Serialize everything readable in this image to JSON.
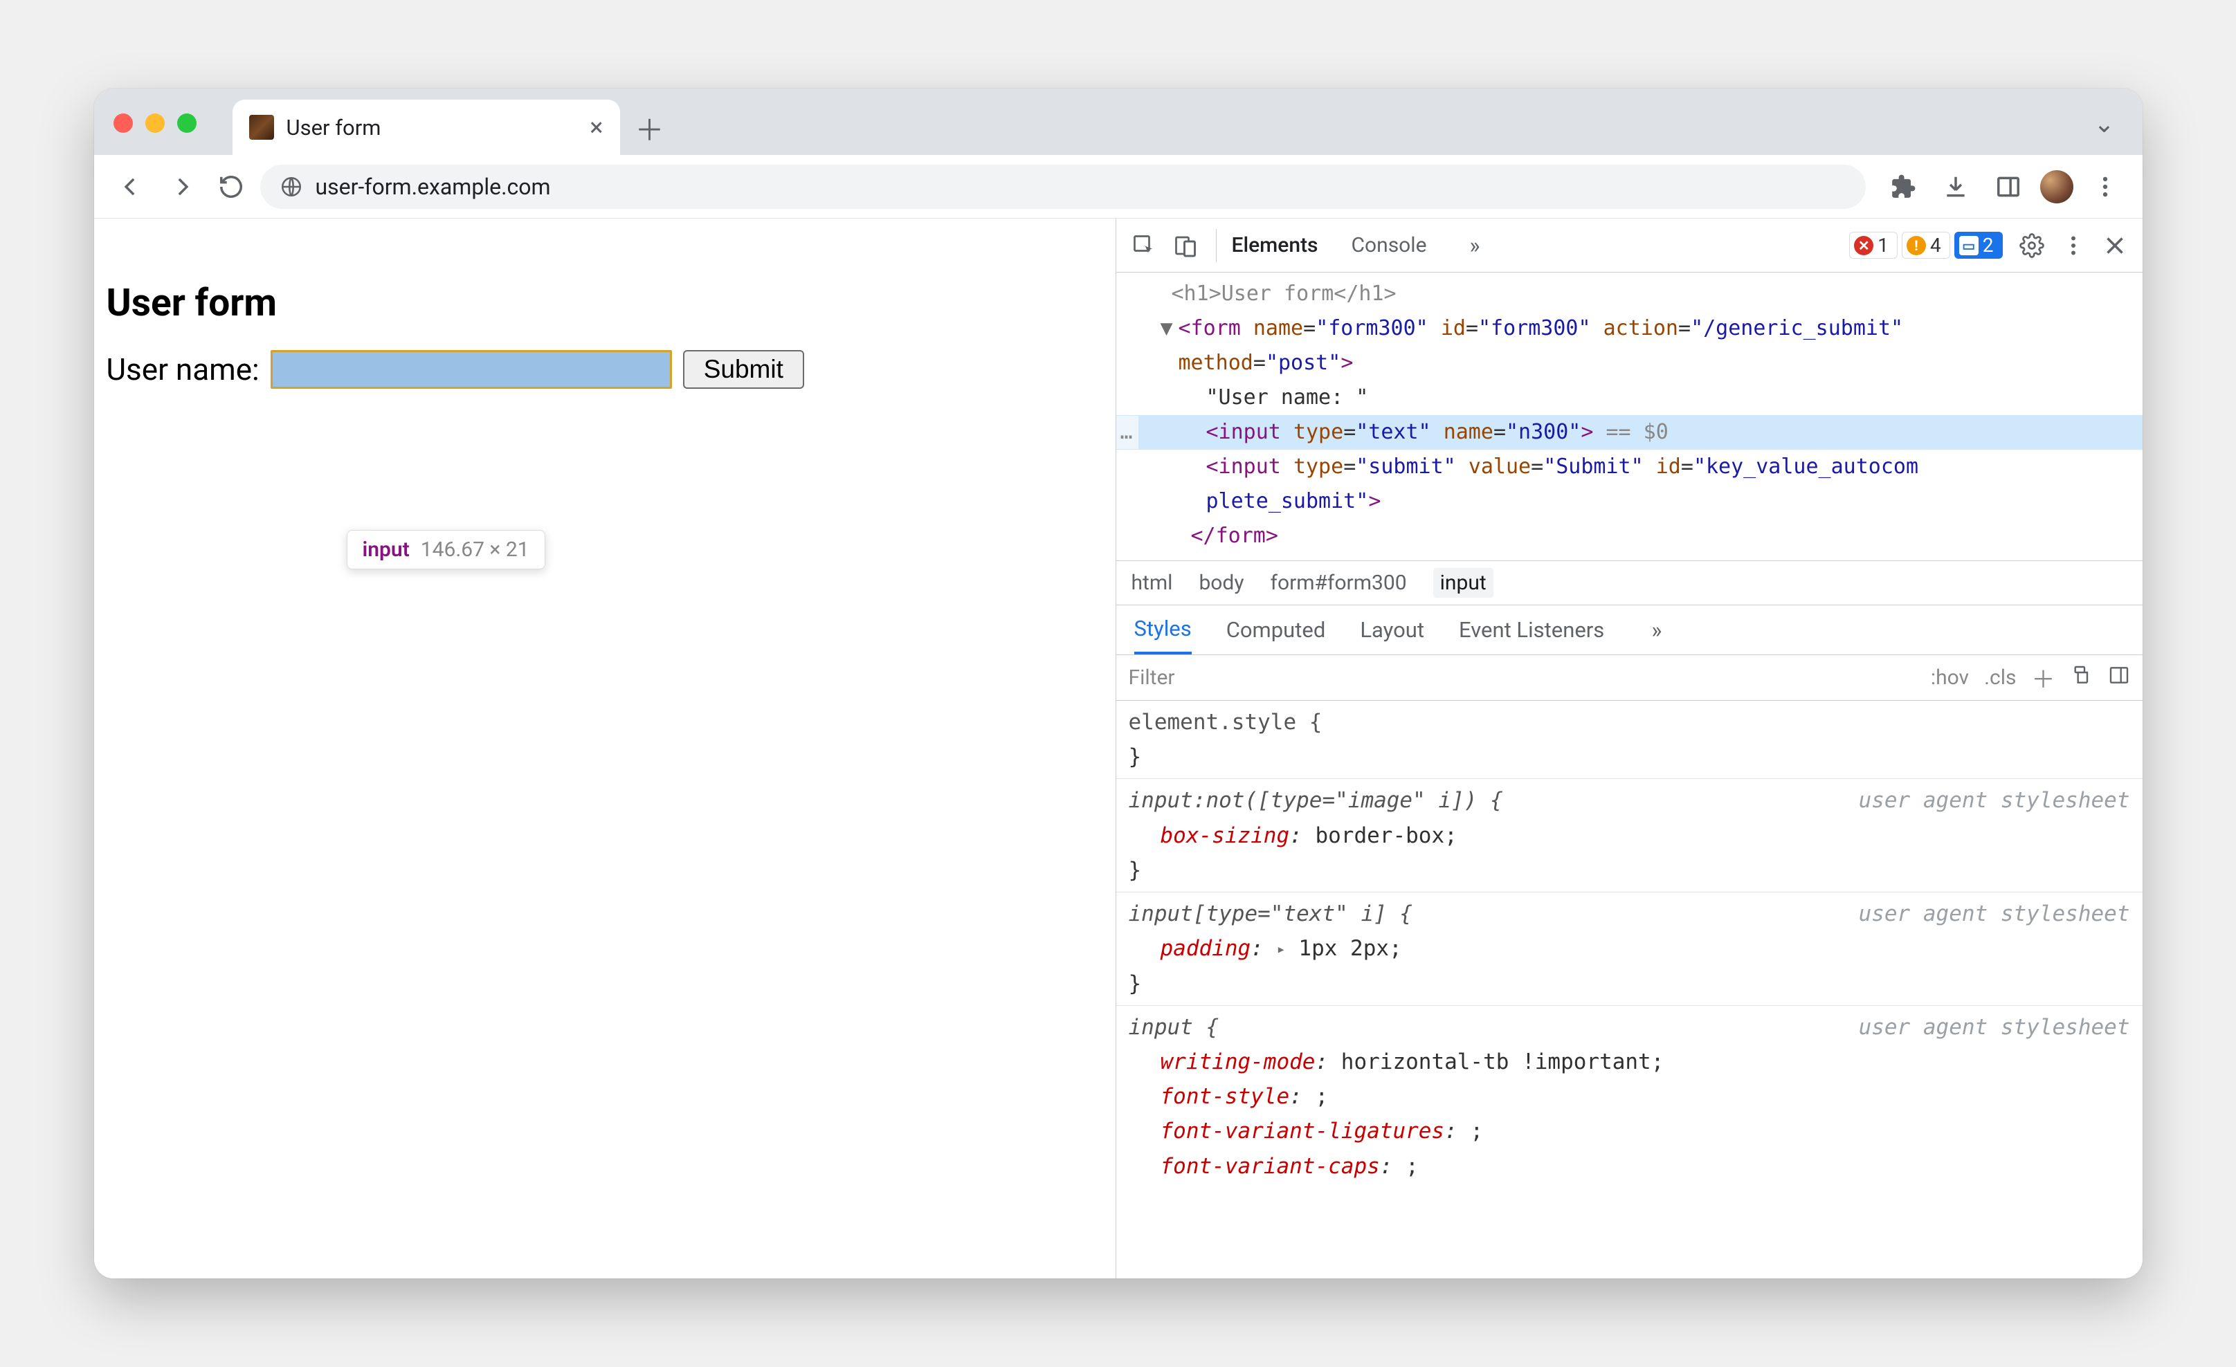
{
  "browser": {
    "tab_title": "User form",
    "url": "user-form.example.com"
  },
  "page": {
    "heading": "User form",
    "label": "User name:",
    "submit": "Submit"
  },
  "tooltip": {
    "tag": "input",
    "dims": "146.67 × 21"
  },
  "devtools": {
    "tabs": {
      "elements": "Elements",
      "console": "Console"
    },
    "badge_err": "1",
    "badge_warn": "4",
    "badge_msg": "2",
    "dom": {
      "line0_cut": "<h1>User form</h1>",
      "form_open_1": "<form name=\"form300\" id=\"form300\" action=\"/generic_submit\"",
      "form_open_2": "method=\"post\">",
      "text_node": "\"User name: \"",
      "input_text": "<input type=\"text\" name=\"n300\">",
      "eq0": " == $0",
      "input_submit_1": "<input type=\"submit\" value=\"Submit\" id=\"key_value_autocom",
      "input_submit_2": "plete_submit\">",
      "form_close": "</form>"
    },
    "breadcrumb": [
      "html",
      "body",
      "form#form300",
      "input"
    ],
    "styles_tabs": {
      "styles": "Styles",
      "computed": "Computed",
      "layout": "Layout",
      "listeners": "Event Listeners"
    },
    "filter_placeholder": "Filter",
    "hov": ":hov",
    "cls": ".cls",
    "rules": {
      "r0_sel": "element.style {",
      "r1_sel": "input:not([type=\"image\" i]) {",
      "r1_src": "user agent stylesheet",
      "r1_p1": "box-sizing",
      "r1_v1": "border-box",
      "r2_sel": "input[type=\"text\" i] {",
      "r2_src": "user agent stylesheet",
      "r2_p1": "padding",
      "r2_v1": "1px 2px",
      "r3_sel": "input {",
      "r3_src": "user agent stylesheet",
      "r3_p1": "writing-mode",
      "r3_v1": "horizontal-tb !important",
      "r3_p2": "font-style",
      "r3_v2": "",
      "r3_p3": "font-variant-ligatures",
      "r3_v3": "",
      "r3_p4": "font-variant-caps",
      "r3_v4": ""
    }
  }
}
